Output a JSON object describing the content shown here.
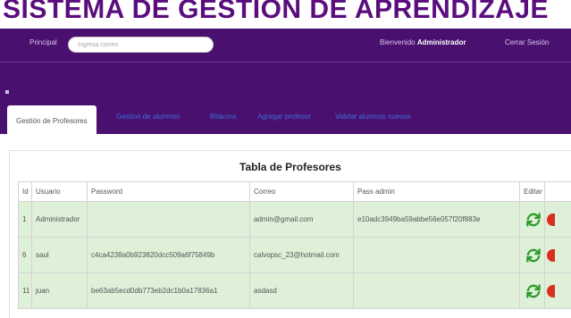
{
  "app": {
    "title": "SISTEMA DE GESTION DE APRENDIZAJE"
  },
  "topnav": {
    "home_label": "Principal",
    "search_placeholder": "Ingresa correo",
    "welcome_prefix": "Bienvenido",
    "welcome_user": "Administrador",
    "logout_label": "Cerrar Sesión"
  },
  "tabs": [
    {
      "label": "Gestión de Profesores",
      "active": true
    },
    {
      "label": "Gestion de alumnos",
      "active": false
    },
    {
      "label": "Bitácora",
      "active": false
    },
    {
      "label": "Agregar profesor",
      "active": false
    },
    {
      "label": "Validar alumnos nuevos",
      "active": false
    }
  ],
  "table": {
    "title": "Tabla de Profesores",
    "headers": [
      "Id",
      "Usuario",
      "Password",
      "Correo",
      "Pass admin",
      "Editar",
      ""
    ],
    "rows": [
      {
        "id": "1",
        "usuario": "Administrador",
        "password": "",
        "correo": "admin@gmail.com",
        "pass_admin": "e10adc3949ba59abbe56e057f20f883e"
      },
      {
        "id": "6",
        "usuario": "saul",
        "password": "c4ca4238a0b923820dcc509a6f75849b",
        "correo": "calvopsc_23@hotmail.com",
        "pass_admin": ""
      },
      {
        "id": "11",
        "usuario": "juan",
        "password": "be63ab5ecd0db773eb2dc1b0a17836a1",
        "correo": "asdasd",
        "pass_admin": ""
      }
    ]
  },
  "colors": {
    "header_bg": "#4a1070",
    "title_color": "#5b0d7e",
    "row_bg": "#def0d8",
    "tab_link": "#3a6fd8",
    "edit_icon": "#2e9a2e",
    "delete_icon": "#d9301e"
  },
  "icons": {
    "edit": "refresh-arrows-icon",
    "delete": "delete-icon"
  }
}
